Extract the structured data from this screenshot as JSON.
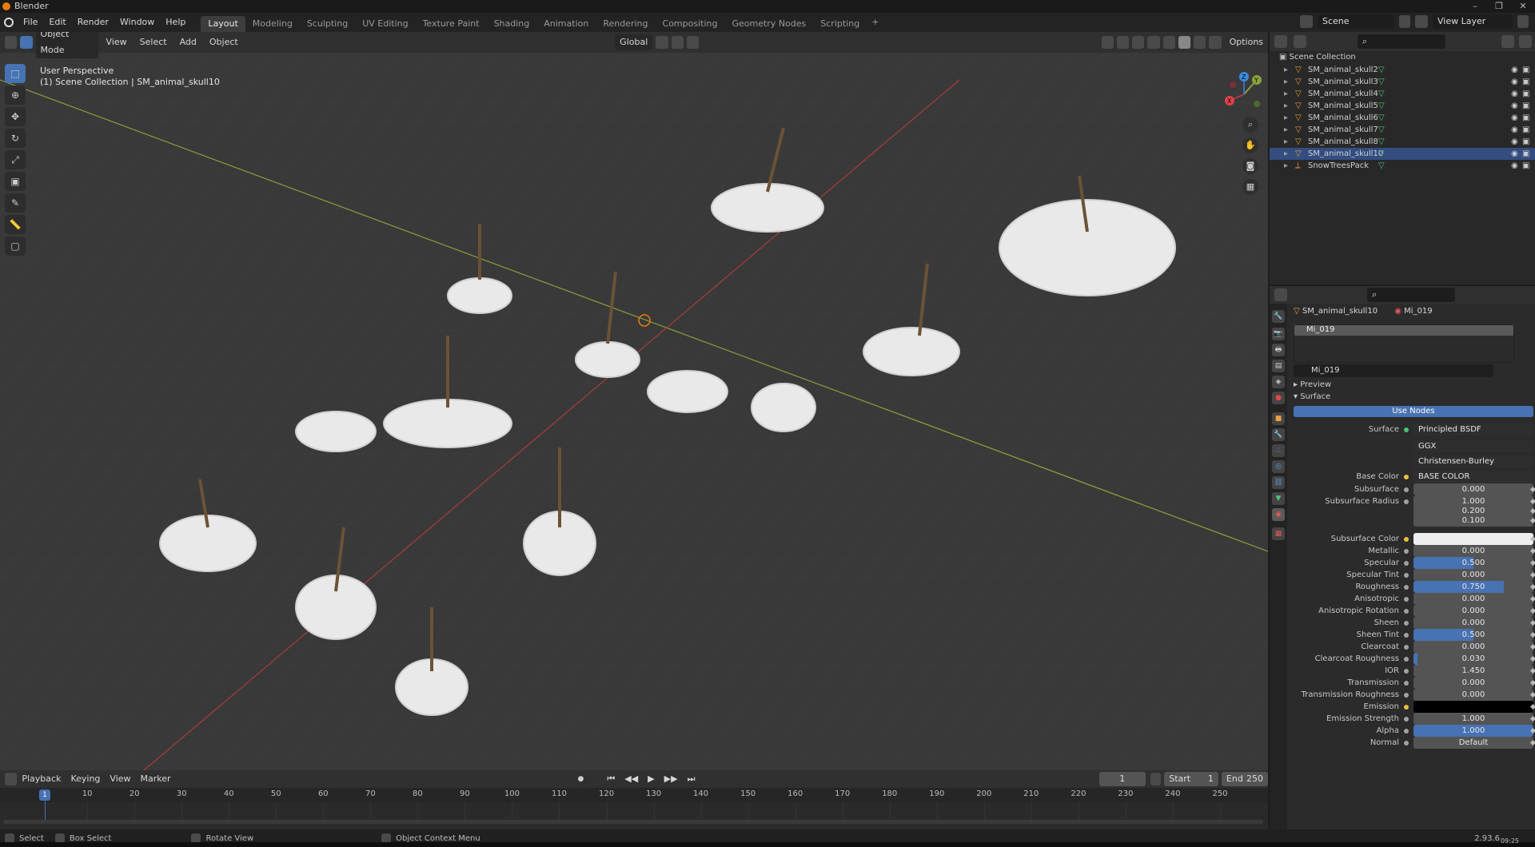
{
  "window": {
    "title": "Blender",
    "controls": [
      "–",
      "❐",
      "✕"
    ]
  },
  "menubar": {
    "menus": [
      "File",
      "Edit",
      "Render",
      "Window",
      "Help"
    ],
    "workspaces": [
      "Layout",
      "Modeling",
      "Sculpting",
      "UV Editing",
      "Texture Paint",
      "Shading",
      "Animation",
      "Rendering",
      "Compositing",
      "Geometry Nodes",
      "Scripting"
    ],
    "active_workspace": "Layout",
    "add": "+",
    "scene": "Scene",
    "view_layer": "View Layer"
  },
  "viewport": {
    "mode": "Object Mode",
    "menus": [
      "View",
      "Select",
      "Add",
      "Object"
    ],
    "transform_orientation": "Global",
    "options": "Options",
    "info_line1": "User Perspective",
    "info_line2": "(1) Scene Collection | SM_animal_skull10",
    "gizmo_axes": [
      "X",
      "Y",
      "Z"
    ]
  },
  "outliner": {
    "root": "Scene Collection",
    "items": [
      {
        "name": "SM_animal_skull2",
        "selected": false
      },
      {
        "name": "SM_animal_skull3",
        "selected": false
      },
      {
        "name": "SM_animal_skull4",
        "selected": false
      },
      {
        "name": "SM_animal_skull5",
        "selected": false
      },
      {
        "name": "SM_animal_skull6",
        "selected": false
      },
      {
        "name": "SM_animal_skull7",
        "selected": false
      },
      {
        "name": "SM_animal_skull8",
        "selected": false
      },
      {
        "name": "SM_animal_skull10",
        "selected": true
      },
      {
        "name": "SnowTreesPack",
        "selected": false
      }
    ]
  },
  "properties": {
    "object": "SM_animal_skull10",
    "material": "Mi_019",
    "slot": "Mi_019",
    "material_field": "Mi_019",
    "sections": {
      "preview": "Preview",
      "surface": "Surface"
    },
    "use_nodes": "Use Nodes",
    "surface_label": "Surface",
    "surface_value": "Principled BSDF",
    "distribution": "GGX",
    "subsurface_method": "Christensen-Burley",
    "base_color_label": "Base Color",
    "base_color_value": "BASE COLOR",
    "rows": [
      {
        "label": "Subsurface",
        "value": "0.000",
        "fill": 0
      },
      {
        "label": "Subsurface Radius",
        "value": "1.000",
        "fill": 0
      },
      {
        "label": "",
        "value": "0.200",
        "fill": 0
      },
      {
        "label": "",
        "value": "0.100",
        "fill": 0
      },
      {
        "label": "Subsurface Color",
        "value": "",
        "fill": 0,
        "color": "#eeeeee"
      },
      {
        "label": "Metallic",
        "value": "0.000",
        "fill": 0
      },
      {
        "label": "Specular",
        "value": "0.500",
        "fill": 0.5
      },
      {
        "label": "Specular Tint",
        "value": "0.000",
        "fill": 0
      },
      {
        "label": "Roughness",
        "value": "0.750",
        "fill": 0.75
      },
      {
        "label": "Anisotropic",
        "value": "0.000",
        "fill": 0
      },
      {
        "label": "Anisotropic Rotation",
        "value": "0.000",
        "fill": 0
      },
      {
        "label": "Sheen",
        "value": "0.000",
        "fill": 0
      },
      {
        "label": "Sheen Tint",
        "value": "0.500",
        "fill": 0.5
      },
      {
        "label": "Clearcoat",
        "value": "0.000",
        "fill": 0
      },
      {
        "label": "Clearcoat Roughness",
        "value": "0.030",
        "fill": 0.03
      },
      {
        "label": "IOR",
        "value": "1.450",
        "fill": 0
      },
      {
        "label": "Transmission",
        "value": "0.000",
        "fill": 0
      },
      {
        "label": "Transmission Roughness",
        "value": "0.000",
        "fill": 0
      },
      {
        "label": "Emission",
        "value": "",
        "fill": 0,
        "color": "#000000"
      },
      {
        "label": "Emission Strength",
        "value": "1.000",
        "fill": 0
      },
      {
        "label": "Alpha",
        "value": "1.000",
        "fill": 1
      },
      {
        "label": "Normal",
        "value": "Default",
        "fill": 0
      }
    ]
  },
  "timeline": {
    "menus": [
      "Playback",
      "Keying",
      "View",
      "Marker"
    ],
    "current_frame": "1",
    "start_label": "Start",
    "start": "1",
    "end_label": "End",
    "end": "250",
    "ticks": [
      "1",
      "10",
      "20",
      "30",
      "40",
      "50",
      "60",
      "70",
      "80",
      "90",
      "100",
      "110",
      "120",
      "130",
      "140",
      "150",
      "160",
      "170",
      "180",
      "190",
      "200",
      "210",
      "220",
      "230",
      "240",
      "250"
    ]
  },
  "statusbar": {
    "items": [
      "Select",
      "Box Select",
      "Rotate View",
      "Object Context Menu"
    ],
    "version": "2.93.6",
    "clock": "09:25"
  },
  "colors": {
    "accent": "#4772b3",
    "selected_row": "#334d80",
    "object_origin": "#e87d0d",
    "x_axis": "#a83c3c",
    "y_axis": "#8aa13a"
  }
}
